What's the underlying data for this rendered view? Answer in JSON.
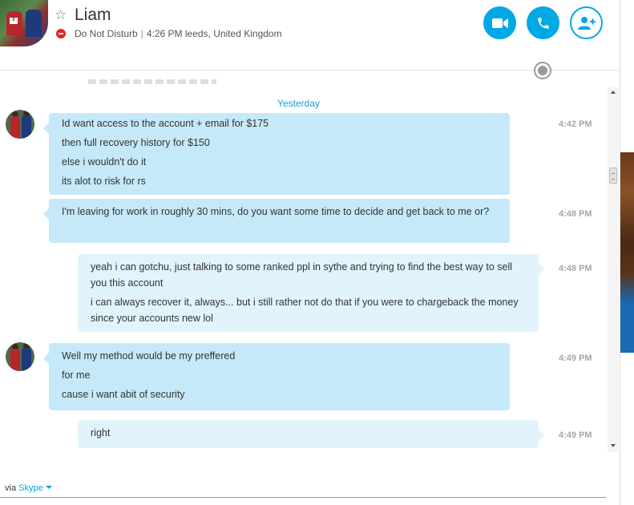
{
  "header": {
    "contact_name": "Liam",
    "status_text": "Do Not Disturb",
    "separator": "|",
    "local_time": "4:26 PM leeds, United Kingdom",
    "icons": {
      "favorite": "star-outline-icon",
      "status": "do-not-disturb-icon",
      "video": "video-camera-icon",
      "call": "phone-icon",
      "add_people": "add-person-icon",
      "language": "globe-icon"
    }
  },
  "conversation": {
    "day_divider": "Yesterday",
    "messages": [
      {
        "direction": "incoming",
        "time": "4:42 PM",
        "lines": [
          "Id want access to the account + email for $175",
          "then full recovery history for $150",
          "else i wouldn't do it",
          "its alot to risk for rs"
        ]
      },
      {
        "direction": "incoming",
        "time": "4:48 PM",
        "lines": [
          "I'm leaving for work in roughly 30 mins, do you want some time to decide and get back to me or?"
        ]
      },
      {
        "direction": "outgoing",
        "time": "4:48 PM",
        "lines": [
          "yeah i can gotchu, just talking to some ranked ppl in sythe and trying to find the best way to sell you this account",
          "i can always recover it, always... but i still rather not do that if you were to chargeback the money since your accounts new lol"
        ]
      },
      {
        "direction": "incoming",
        "time": "4:49 PM",
        "lines": [
          "Well my method would be my preffered",
          "for me",
          "cause i want abit of security"
        ]
      },
      {
        "direction": "outgoing",
        "time": "4:49 PM",
        "lines": [
          "right"
        ]
      }
    ]
  },
  "footer": {
    "via_label": "via",
    "service": "Skype"
  },
  "colors": {
    "accent": "#00a8e6",
    "incoming_bubble": "#c6e9f9",
    "outgoing_bubble": "#e1f4fc",
    "dnd_red": "#e2262a"
  }
}
